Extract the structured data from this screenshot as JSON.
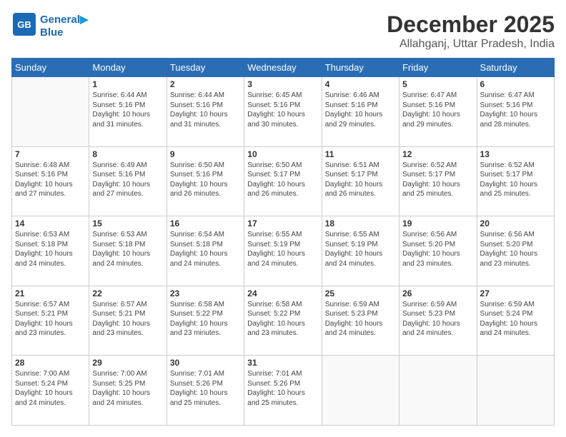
{
  "logo": {
    "line1": "General",
    "line2": "Blue"
  },
  "header": {
    "month": "December 2025",
    "location": "Allahganj, Uttar Pradesh, India"
  },
  "weekdays": [
    "Sunday",
    "Monday",
    "Tuesday",
    "Wednesday",
    "Thursday",
    "Friday",
    "Saturday"
  ],
  "weeks": [
    [
      {
        "day": "",
        "lines": [],
        "empty": true
      },
      {
        "day": "1",
        "lines": [
          "Sunrise: 6:44 AM",
          "Sunset: 5:16 PM",
          "Daylight: 10 hours",
          "and 31 minutes."
        ]
      },
      {
        "day": "2",
        "lines": [
          "Sunrise: 6:44 AM",
          "Sunset: 5:16 PM",
          "Daylight: 10 hours",
          "and 31 minutes."
        ]
      },
      {
        "day": "3",
        "lines": [
          "Sunrise: 6:45 AM",
          "Sunset: 5:16 PM",
          "Daylight: 10 hours",
          "and 30 minutes."
        ]
      },
      {
        "day": "4",
        "lines": [
          "Sunrise: 6:46 AM",
          "Sunset: 5:16 PM",
          "Daylight: 10 hours",
          "and 29 minutes."
        ]
      },
      {
        "day": "5",
        "lines": [
          "Sunrise: 6:47 AM",
          "Sunset: 5:16 PM",
          "Daylight: 10 hours",
          "and 29 minutes."
        ]
      },
      {
        "day": "6",
        "lines": [
          "Sunrise: 6:47 AM",
          "Sunset: 5:16 PM",
          "Daylight: 10 hours",
          "and 28 minutes."
        ]
      }
    ],
    [
      {
        "day": "7",
        "lines": [
          "Sunrise: 6:48 AM",
          "Sunset: 5:16 PM",
          "Daylight: 10 hours",
          "and 27 minutes."
        ]
      },
      {
        "day": "8",
        "lines": [
          "Sunrise: 6:49 AM",
          "Sunset: 5:16 PM",
          "Daylight: 10 hours",
          "and 27 minutes."
        ]
      },
      {
        "day": "9",
        "lines": [
          "Sunrise: 6:50 AM",
          "Sunset: 5:16 PM",
          "Daylight: 10 hours",
          "and 26 minutes."
        ]
      },
      {
        "day": "10",
        "lines": [
          "Sunrise: 6:50 AM",
          "Sunset: 5:17 PM",
          "Daylight: 10 hours",
          "and 26 minutes."
        ]
      },
      {
        "day": "11",
        "lines": [
          "Sunrise: 6:51 AM",
          "Sunset: 5:17 PM",
          "Daylight: 10 hours",
          "and 26 minutes."
        ]
      },
      {
        "day": "12",
        "lines": [
          "Sunrise: 6:52 AM",
          "Sunset: 5:17 PM",
          "Daylight: 10 hours",
          "and 25 minutes."
        ]
      },
      {
        "day": "13",
        "lines": [
          "Sunrise: 6:52 AM",
          "Sunset: 5:17 PM",
          "Daylight: 10 hours",
          "and 25 minutes."
        ]
      }
    ],
    [
      {
        "day": "14",
        "lines": [
          "Sunrise: 6:53 AM",
          "Sunset: 5:18 PM",
          "Daylight: 10 hours",
          "and 24 minutes."
        ]
      },
      {
        "day": "15",
        "lines": [
          "Sunrise: 6:53 AM",
          "Sunset: 5:18 PM",
          "Daylight: 10 hours",
          "and 24 minutes."
        ]
      },
      {
        "day": "16",
        "lines": [
          "Sunrise: 6:54 AM",
          "Sunset: 5:18 PM",
          "Daylight: 10 hours",
          "and 24 minutes."
        ]
      },
      {
        "day": "17",
        "lines": [
          "Sunrise: 6:55 AM",
          "Sunset: 5:19 PM",
          "Daylight: 10 hours",
          "and 24 minutes."
        ]
      },
      {
        "day": "18",
        "lines": [
          "Sunrise: 6:55 AM",
          "Sunset: 5:19 PM",
          "Daylight: 10 hours",
          "and 24 minutes."
        ]
      },
      {
        "day": "19",
        "lines": [
          "Sunrise: 6:56 AM",
          "Sunset: 5:20 PM",
          "Daylight: 10 hours",
          "and 23 minutes."
        ]
      },
      {
        "day": "20",
        "lines": [
          "Sunrise: 6:56 AM",
          "Sunset: 5:20 PM",
          "Daylight: 10 hours",
          "and 23 minutes."
        ]
      }
    ],
    [
      {
        "day": "21",
        "lines": [
          "Sunrise: 6:57 AM",
          "Sunset: 5:21 PM",
          "Daylight: 10 hours",
          "and 23 minutes."
        ]
      },
      {
        "day": "22",
        "lines": [
          "Sunrise: 6:57 AM",
          "Sunset: 5:21 PM",
          "Daylight: 10 hours",
          "and 23 minutes."
        ]
      },
      {
        "day": "23",
        "lines": [
          "Sunrise: 6:58 AM",
          "Sunset: 5:22 PM",
          "Daylight: 10 hours",
          "and 23 minutes."
        ]
      },
      {
        "day": "24",
        "lines": [
          "Sunrise: 6:58 AM",
          "Sunset: 5:22 PM",
          "Daylight: 10 hours",
          "and 23 minutes."
        ]
      },
      {
        "day": "25",
        "lines": [
          "Sunrise: 6:59 AM",
          "Sunset: 5:23 PM",
          "Daylight: 10 hours",
          "and 24 minutes."
        ]
      },
      {
        "day": "26",
        "lines": [
          "Sunrise: 6:59 AM",
          "Sunset: 5:23 PM",
          "Daylight: 10 hours",
          "and 24 minutes."
        ]
      },
      {
        "day": "27",
        "lines": [
          "Sunrise: 6:59 AM",
          "Sunset: 5:24 PM",
          "Daylight: 10 hours",
          "and 24 minutes."
        ]
      }
    ],
    [
      {
        "day": "28",
        "lines": [
          "Sunrise: 7:00 AM",
          "Sunset: 5:24 PM",
          "Daylight: 10 hours",
          "and 24 minutes."
        ]
      },
      {
        "day": "29",
        "lines": [
          "Sunrise: 7:00 AM",
          "Sunset: 5:25 PM",
          "Daylight: 10 hours",
          "and 24 minutes."
        ]
      },
      {
        "day": "30",
        "lines": [
          "Sunrise: 7:01 AM",
          "Sunset: 5:26 PM",
          "Daylight: 10 hours",
          "and 25 minutes."
        ]
      },
      {
        "day": "31",
        "lines": [
          "Sunrise: 7:01 AM",
          "Sunset: 5:26 PM",
          "Daylight: 10 hours",
          "and 25 minutes."
        ]
      },
      {
        "day": "",
        "lines": [],
        "empty": true
      },
      {
        "day": "",
        "lines": [],
        "empty": true
      },
      {
        "day": "",
        "lines": [],
        "empty": true
      }
    ]
  ]
}
